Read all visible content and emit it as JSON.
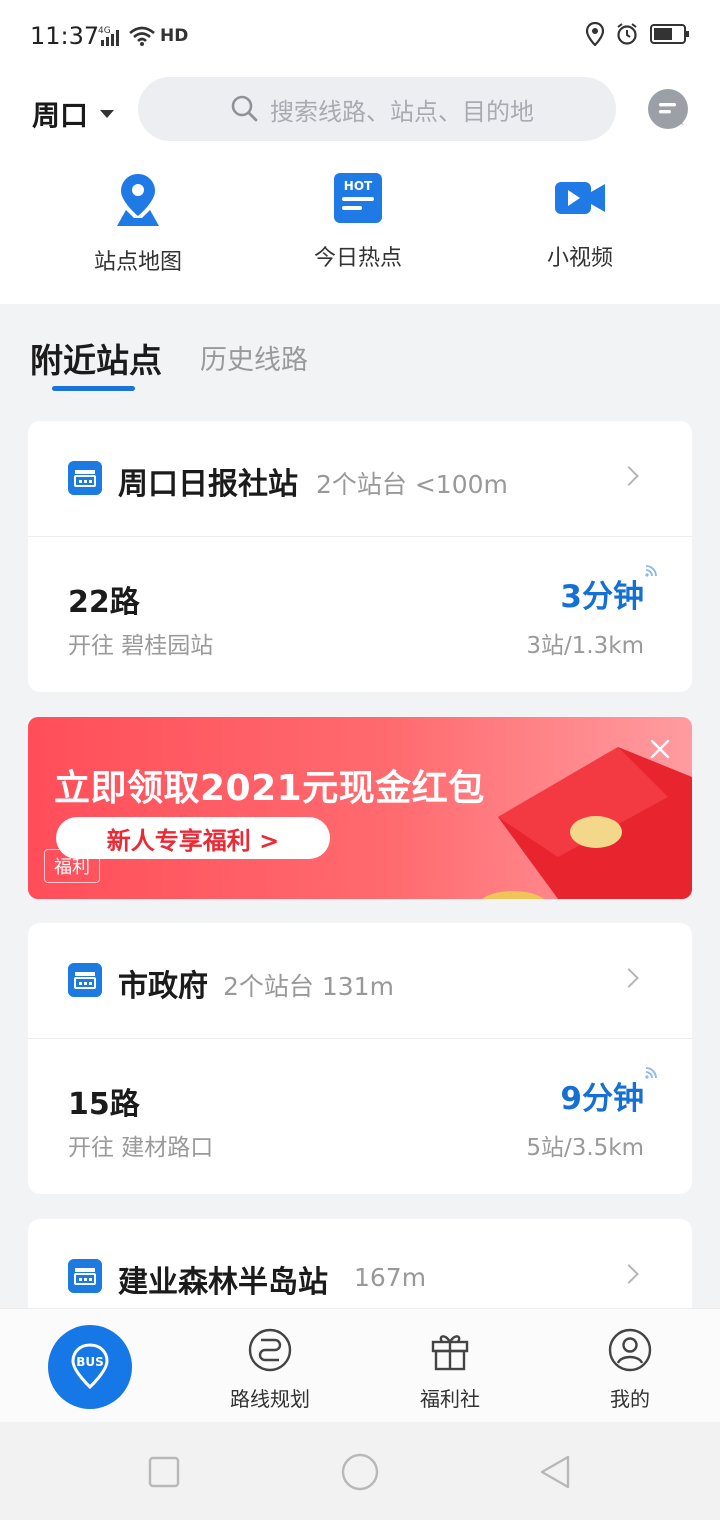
{
  "status_bar": {
    "time": "11:37",
    "network": "4G",
    "hd": "HD"
  },
  "header": {
    "city": "周口",
    "search_placeholder": "搜索线路、站点、目的地",
    "quick_actions": [
      {
        "label": "站点地图",
        "icon": "map-pin-icon"
      },
      {
        "label": "今日热点",
        "icon": "hot-news-icon",
        "badge": "HOT"
      },
      {
        "label": "小视频",
        "icon": "video-camera-icon"
      }
    ]
  },
  "tabs": {
    "active": "附近站点",
    "inactive": "历史线路"
  },
  "stations": [
    {
      "name": "周口日报社站",
      "meta": "2个站台 <100m",
      "route": "22路",
      "direction": "开往 碧桂园站",
      "eta": "3分钟",
      "distance": "3站/1.3km"
    },
    {
      "name": "市政府",
      "meta": "2个站台 131m",
      "route": "15路",
      "direction": "开往 建材路口",
      "eta": "9分钟",
      "distance": "5站/3.5km"
    },
    {
      "name": "建业森林半岛站",
      "meta": "167m"
    }
  ],
  "banner": {
    "title": "立即领取2021元现金红包",
    "cta": "新人专享福利 >",
    "tag": "福利"
  },
  "bottom_nav": {
    "bus_badge": "BUS",
    "items": [
      {
        "label": "路线规划"
      },
      {
        "label": "福利社"
      },
      {
        "label": "我的"
      }
    ]
  },
  "colors": {
    "accent": "#1677e6",
    "eta": "#1570d6",
    "banner": "#ff4e5a"
  }
}
